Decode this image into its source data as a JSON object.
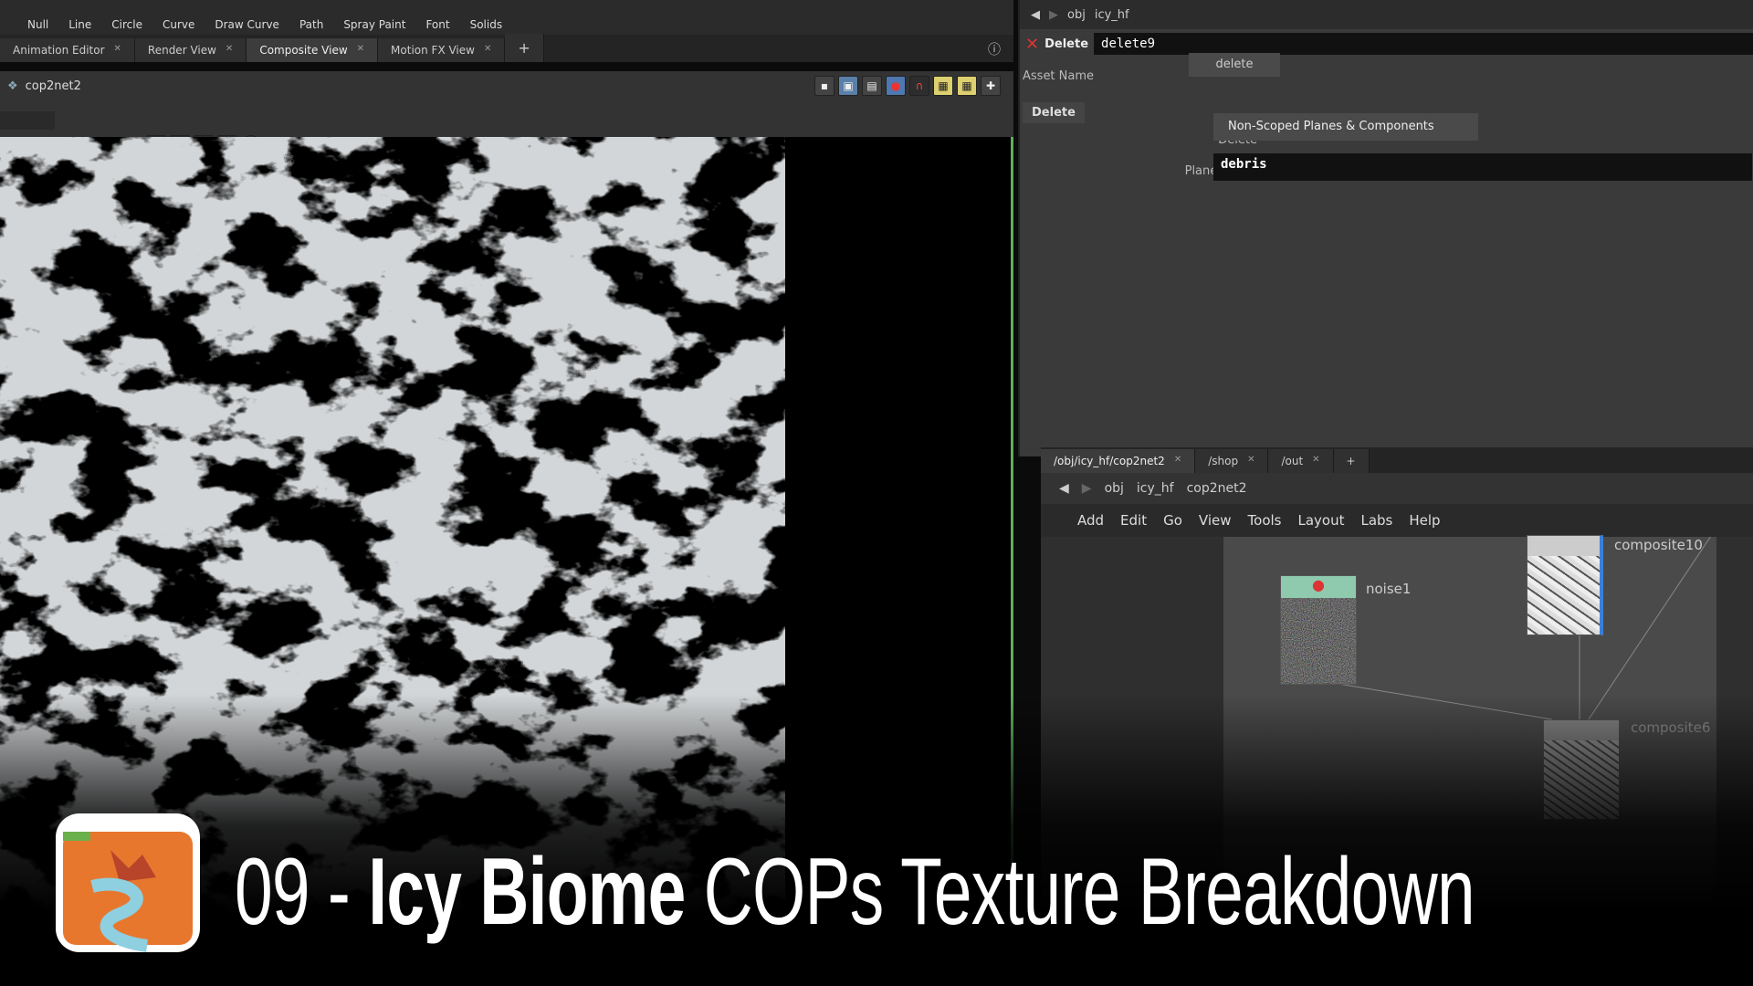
{
  "shelf_tools": [
    "Null",
    "Line",
    "Circle",
    "Curve",
    "Draw Curve",
    "Path",
    "Spray Paint",
    "Font",
    "Solids"
  ],
  "left_tabs": [
    {
      "label": "Animation Editor"
    },
    {
      "label": "Render View"
    },
    {
      "label": "Composite View",
      "active": true
    },
    {
      "label": "Motion FX View"
    }
  ],
  "viewer": {
    "network": "cop2net2",
    "tiles": "2x2"
  },
  "params": {
    "path": [
      "obj",
      "icy_hf"
    ],
    "node_type": "Delete",
    "node_name": "delete9",
    "asset_name_label": "Asset Name",
    "asset_name_value": "delete",
    "section_tab": "Delete",
    "delete_label": "Delete",
    "delete_value": "Non-Scoped Planes & Components",
    "plane_scope_label": "Plane Scope",
    "plane_scope_value": "debris"
  },
  "network": {
    "tabs": [
      "/obj/icy_hf/cop2net2",
      "/shop",
      "/out"
    ],
    "path": [
      "obj",
      "icy_hf",
      "cop2net2"
    ],
    "menu": [
      "Add",
      "Edit",
      "Go",
      "View",
      "Tools",
      "Layout",
      "Labs",
      "Help"
    ],
    "nodes": [
      {
        "name": "noise1"
      },
      {
        "name": "composite10"
      },
      {
        "name": "composite6"
      }
    ]
  },
  "overlay": {
    "number": "09 - ",
    "bold": "Icy Biome",
    "rest": " COPs Texture Breakdown"
  },
  "colors": {
    "accent_green": "#5fae5f",
    "node_teal": "#8fc9ae",
    "selection_blue": "#3b7fd6",
    "logo_orange": "#e8772e"
  }
}
